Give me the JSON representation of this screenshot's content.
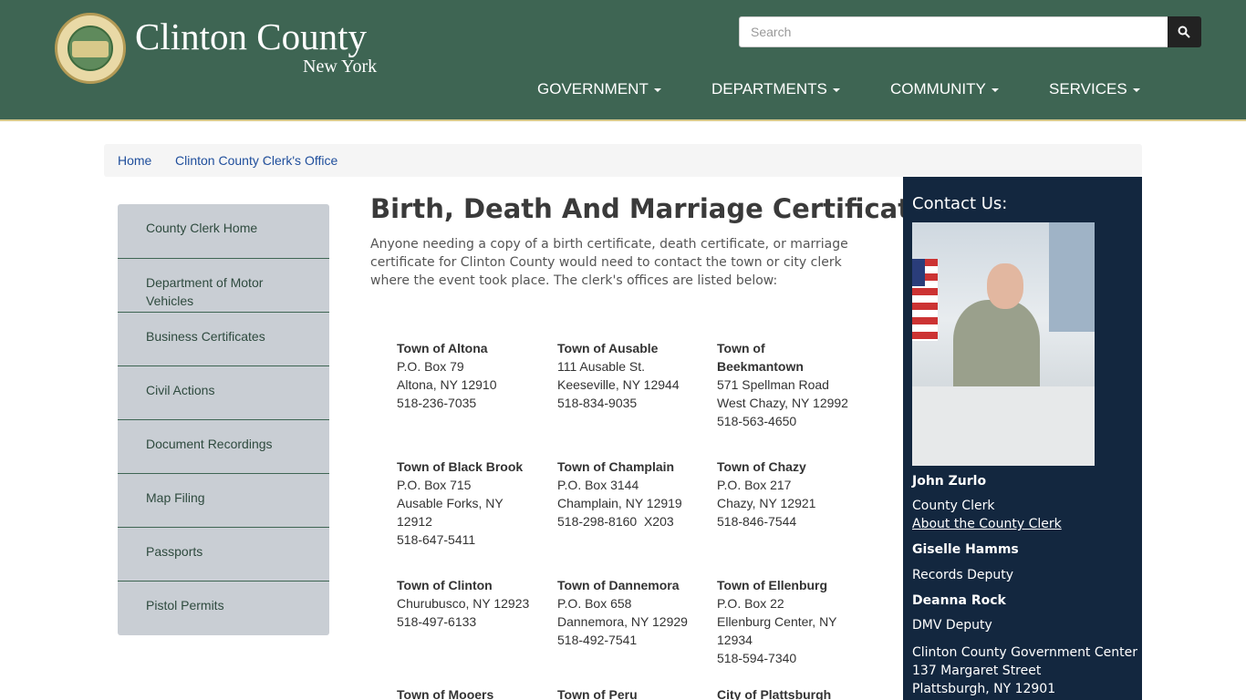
{
  "header": {
    "title": "Clinton County",
    "subtitle": "New York",
    "search_placeholder": "Search",
    "nav": [
      {
        "label": "GOVERNMENT"
      },
      {
        "label": "DEPARTMENTS"
      },
      {
        "label": "COMMUNITY"
      },
      {
        "label": "SERVICES"
      }
    ]
  },
  "breadcrumb": {
    "home": "Home",
    "current": "Clinton County Clerk's Office"
  },
  "sidebar": {
    "items": [
      {
        "label": "County Clerk Home"
      },
      {
        "label": "Department of Motor Vehicles"
      },
      {
        "label": "Business Certificates"
      },
      {
        "label": "Civil Actions"
      },
      {
        "label": "Document Recordings"
      },
      {
        "label": "Map Filing"
      },
      {
        "label": "Passports"
      },
      {
        "label": "Pistol Permits"
      }
    ]
  },
  "main": {
    "title": "Birth, Death And Marriage Certificates",
    "intro": "Anyone needing a copy of a birth certificate, death certificate, or marriage certificate for Clinton County would need to contact the town or city clerk where the event took place.  The clerk's offices are listed below:",
    "towns": [
      {
        "name": "Town of Altona",
        "lines": [
          "P.O. Box 79",
          "Altona, NY 12910",
          "518-236-7035"
        ]
      },
      {
        "name": "Town of Ausable",
        "lines": [
          "111 Ausable St.",
          "Keeseville, NY 12944",
          "518-834-9035"
        ]
      },
      {
        "name": "Town of Beekmantown",
        "lines": [
          "571 Spellman Road",
          "West Chazy, NY 12992",
          "518-563-4650"
        ]
      },
      {
        "name": "Town of Black Brook",
        "lines": [
          "P.O. Box 715",
          "Ausable Forks, NY 12912",
          "518-647-5411"
        ]
      },
      {
        "name": "Town of Champlain",
        "lines": [
          "P.O. Box 3144",
          "Champlain, NY 12919",
          "518-298-8160  X203"
        ]
      },
      {
        "name": "Town of Chazy",
        "lines": [
          "P.O. Box 217",
          "Chazy, NY 12921",
          "518-846-7544"
        ]
      },
      {
        "name": "Town of Clinton",
        "lines": [
          "Churubusco, NY 12923",
          "518-497-6133"
        ]
      },
      {
        "name": "Town of Dannemora",
        "lines": [
          "P.O. Box 658",
          "Dannemora, NY 12929",
          "518-492-7541"
        ]
      },
      {
        "name": "Town of Ellenburg",
        "lines": [
          "P.O. Box 22",
          "Ellenburg Center, NY 12934",
          "518-594-7340"
        ]
      },
      {
        "name": "Town of Mooers",
        "lines": []
      },
      {
        "name": "Town of Peru",
        "lines": []
      },
      {
        "name": "City of Plattsburgh",
        "lines": []
      }
    ]
  },
  "contact": {
    "title": "Contact Us:",
    "clerk_name": "John Zurlo",
    "clerk_role": "County Clerk",
    "clerk_link": "About the County Clerk",
    "deputy1_name": "Giselle Hamms",
    "deputy1_role": "Records Deputy",
    "deputy2_name": "Deanna Rock",
    "deputy2_role": "DMV Deputy",
    "address1": "Clinton County Government Center",
    "address2": "137 Margaret Street",
    "address3": "Plattsburgh, NY  12901"
  },
  "colors": {
    "header_bg": "#3e6553",
    "contact_bg": "#13273f",
    "sidebar_bg": "#c9ced4",
    "link": "#1f4e9c"
  }
}
